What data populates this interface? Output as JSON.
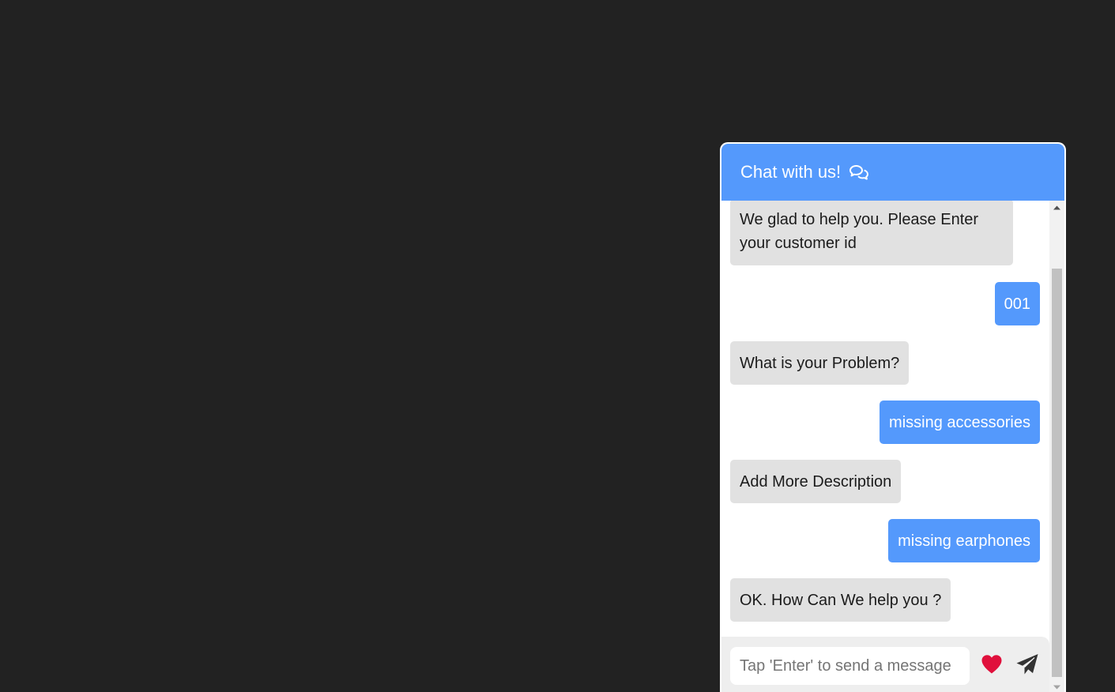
{
  "chat": {
    "title": "Chat with us!",
    "header_icon": "comments-icon",
    "messages": [
      {
        "sender": "bot",
        "text": "We glad to help you. Please Enter your customer id"
      },
      {
        "sender": "user",
        "text": "001"
      },
      {
        "sender": "bot",
        "text": "What is your Problem?"
      },
      {
        "sender": "user",
        "text": "missing accessories"
      },
      {
        "sender": "bot",
        "text": "Add More Description"
      },
      {
        "sender": "user",
        "text": "missing earphones"
      },
      {
        "sender": "bot",
        "text": "OK. How Can We help you ?"
      }
    ],
    "input": {
      "placeholder": "Tap 'Enter' to send a message",
      "value": ""
    },
    "actions": {
      "like_icon": "heart-icon",
      "send_icon": "paper-plane-icon"
    }
  },
  "colors": {
    "page_background": "#222222",
    "accent": "#5499fc",
    "bot_bubble": "#e1e1e1",
    "heart": "#e0103c",
    "send_icon": "#333333"
  }
}
